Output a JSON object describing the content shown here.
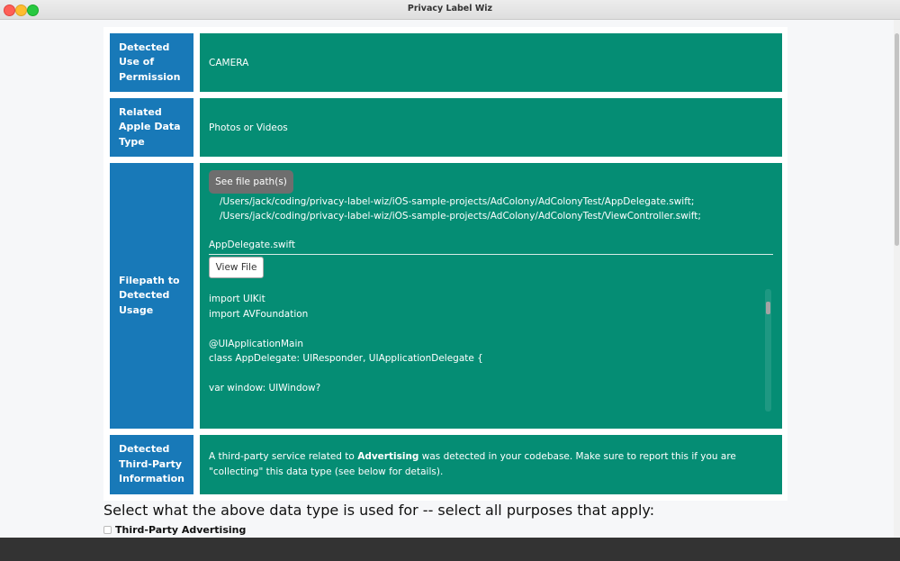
{
  "window": {
    "title": "Privacy Label Wiz"
  },
  "rows": {
    "permission": {
      "label": "Detected Use of Permission",
      "value": "CAMERA"
    },
    "data_type": {
      "label": "Related Apple Data Type",
      "value": "Photos or Videos"
    },
    "filepath": {
      "label": "Filepath to Detected Usage",
      "button_label": "See file path(s)",
      "paths": [
        "/Users/jack/coding/privacy-label-wiz/iOS-sample-projects/AdColony/AdColonyTest/AppDelegate.swift;",
        "/Users/jack/coding/privacy-label-wiz/iOS-sample-projects/AdColony/AdColonyTest/ViewController.swift;"
      ],
      "file_name": "AppDelegate.swift",
      "view_button_label": "View File",
      "code": {
        "l1": "import UIKit",
        "l2": "import AVFoundation",
        "l3": "@UIApplicationMain",
        "l4": "class AppDelegate: UIResponder, UIApplicationDelegate {",
        "l5": "var window: UIWindow?"
      }
    },
    "third_party": {
      "label": "Detected Third-Party Information",
      "text_before": "A third-party service related to ",
      "text_bold": "Advertising",
      "text_after": " was detected in your codebase. Make sure to report this if you are \"collecting\" this data type (see below for details)."
    }
  },
  "purpose": {
    "question": "Select what the above data type is used for -- select all purposes that apply:",
    "options": [
      {
        "label": "Third-Party Advertising",
        "checked": false
      }
    ]
  },
  "colors": {
    "label_bg": "#1879b8",
    "value_bg": "#058d74",
    "button_gray": "#6e6e6e"
  },
  "icons": [
    "close-traffic-light",
    "minimize-traffic-light",
    "maximize-traffic-light"
  ]
}
